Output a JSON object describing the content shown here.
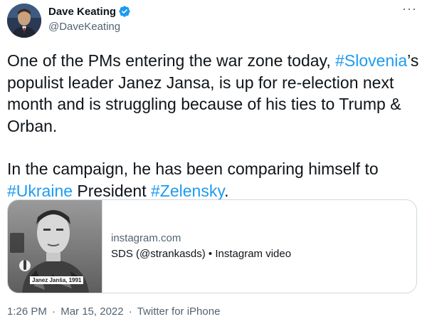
{
  "author": {
    "name": "Dave Keating",
    "handle": "@DaveKeating"
  },
  "tweet": {
    "p1_a": "One of the PMs entering the war zone today, ",
    "p1_tag": "#Slovenia",
    "p1_b": "’s populist leader Janez Jansa, is up for re-election next month and is struggling because of his ties to Trump & Orban.",
    "p2_a": "In the campaign, he has been comparing himself to ",
    "p2_tag1": "#Ukraine",
    "p2_mid": " President ",
    "p2_tag2": "#Zelensky",
    "p2_end": "."
  },
  "card": {
    "thumb_caption": "Janez Janša, 1991",
    "domain": "instagram.com",
    "description": "SDS (@strankasds) • Instagram video"
  },
  "meta": {
    "time": "1:26 PM",
    "separator1": "·",
    "date": "Mar 15, 2022",
    "separator2": "·",
    "source": "Twitter for iPhone"
  },
  "colors": {
    "link": "#1d9bf0",
    "secondary_text": "#536471",
    "border": "#cfd9de"
  },
  "icons": {
    "verified": "verified-badge-icon",
    "more": "more-options-icon"
  }
}
